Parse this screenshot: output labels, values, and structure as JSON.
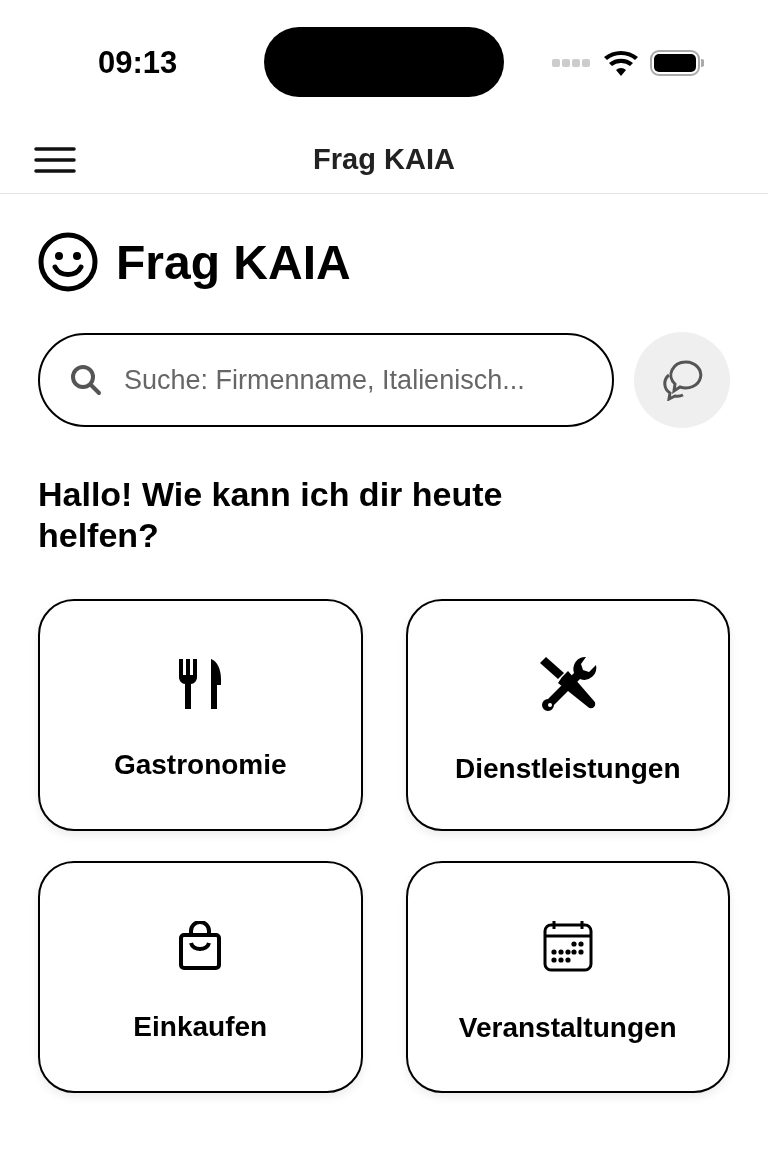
{
  "status_bar": {
    "time": "09:13"
  },
  "nav_bar": {
    "title": "Frag KAIA"
  },
  "header": {
    "title": "Frag KAIA"
  },
  "search": {
    "placeholder": "Suche: Firmenname, Italienisch..."
  },
  "greeting": "Hallo! Wie kann ich dir heute helfen?",
  "categories": [
    {
      "kind": "food",
      "label": "Gastronomie"
    },
    {
      "kind": "tools",
      "label": "Dienstleistungen"
    },
    {
      "kind": "bag",
      "label": "Einkaufen"
    },
    {
      "kind": "calendar",
      "label": "Veranstaltungen"
    }
  ]
}
